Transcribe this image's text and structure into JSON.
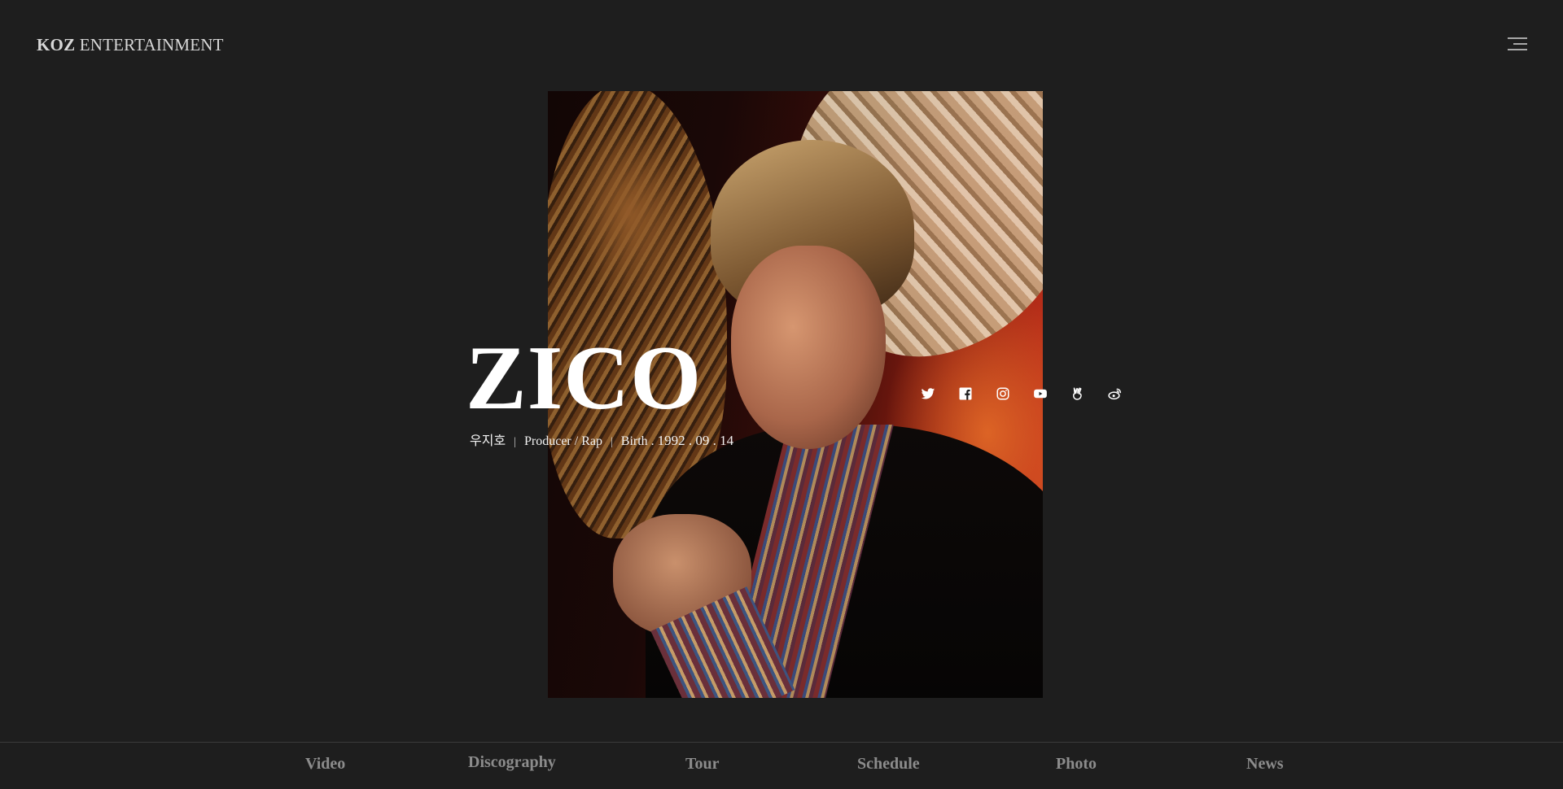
{
  "header": {
    "logo_strong": "KOZ",
    "logo_light": "ENTERTAINMENT"
  },
  "artist": {
    "name": "ZICO",
    "korean_name": "우지호",
    "role": "Producer / Rap",
    "birth_label": "Birth .",
    "birth_value": "1992 . 09 . 14",
    "separator": "|"
  },
  "social_links": [
    {
      "icon": "twitter-icon"
    },
    {
      "icon": "facebook-icon"
    },
    {
      "icon": "instagram-icon"
    },
    {
      "icon": "youtube-icon"
    },
    {
      "icon": "vlive-icon"
    },
    {
      "icon": "weibo-icon"
    }
  ],
  "nav": {
    "items": [
      {
        "label": "Video"
      },
      {
        "label": "Discography"
      },
      {
        "label": "Tour"
      },
      {
        "label": "Schedule"
      },
      {
        "label": "Photo"
      },
      {
        "label": "News"
      }
    ]
  },
  "colors": {
    "background": "#1e1e1e",
    "nav_text": "#8c8c8c",
    "title_text": "#ffffff"
  }
}
